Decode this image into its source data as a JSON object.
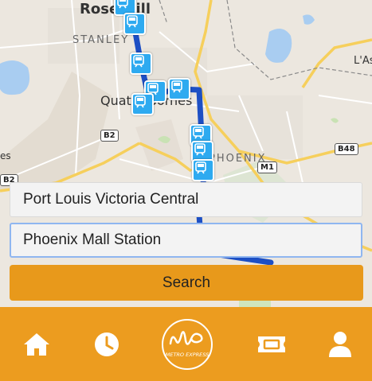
{
  "map": {
    "labels": {
      "rose_hill": "Rose Hill",
      "stanley": "STANLEY",
      "quatre_bornes": "Quatre Bornes",
      "phoenix": "PHOENIX",
      "las": "L'As",
      "es": "es"
    },
    "road_badges": {
      "b2_center": "B2",
      "b2_left": "B2",
      "b48": "B48",
      "m1": "M1"
    },
    "route_color": "#1d4fc4"
  },
  "form": {
    "origin_value": "Port Louis Victoria Central",
    "destination_value": "Phoenix Mall Station",
    "search_label": "Search"
  },
  "navbar": {
    "background": "#ec9c1f",
    "logo_text": "METRO EXPRESS",
    "items": [
      {
        "icon": "home-icon"
      },
      {
        "icon": "clock-icon"
      },
      {
        "icon": "metro-express-logo"
      },
      {
        "icon": "ticket-icon"
      },
      {
        "icon": "user-icon"
      }
    ]
  }
}
